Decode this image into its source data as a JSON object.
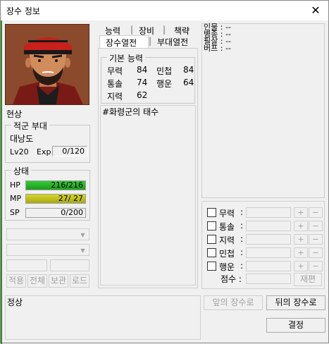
{
  "window": {
    "title": "장수 정보",
    "close_glyph": "✕"
  },
  "general": {
    "name": "현상",
    "affiliation_label": "적군 부대",
    "location": "대낭도",
    "level": "Lv20",
    "exp_label": "Exp",
    "exp_value": "0/120"
  },
  "status": {
    "label": "상태",
    "hp_label": "HP",
    "hp_value": "216/216",
    "hp_ratio": 1.0,
    "mp_label": "MP",
    "mp_value": "27/ 27",
    "mp_ratio": 1.0,
    "sp_label": "SP",
    "sp_value": "0/200",
    "sp_ratio": 0.0,
    "hp_color": "#33cc33",
    "mp_color": "#d6d626"
  },
  "tabs": {
    "top_row": [
      "능력",
      "장비",
      "책략"
    ],
    "bottom_row": [
      "장수열전",
      "부대열전"
    ],
    "active": "장수열전"
  },
  "abilities": {
    "label": "기본 능력",
    "items": [
      {
        "name": "무력",
        "value": "84"
      },
      {
        "name": "민첩",
        "value": "84"
      },
      {
        "name": "통솔",
        "value": "74"
      },
      {
        "name": "행운",
        "value": "64"
      },
      {
        "name": "지력",
        "value": "62"
      }
    ]
  },
  "biography": "#화령군의 태수",
  "info": {
    "lines": [
      {
        "key": "인물",
        "value": ": --"
      },
      {
        "key": "병종",
        "value": ": --"
      },
      {
        "key": "필살",
        "value": ": --"
      },
      {
        "key": "버프",
        "value": ": --"
      }
    ]
  },
  "left_buttons": [
    "적용",
    "전체",
    "보관",
    "로드"
  ],
  "filter": {
    "stats": [
      "무력",
      "통솔",
      "지력",
      "민첩",
      "행운"
    ],
    "colon": ":",
    "plus": "+",
    "minus": "−",
    "score_label": "점수 :",
    "reroll_label": "재편"
  },
  "footer": {
    "condition": "정상",
    "prev_label": "앞의 장수로",
    "next_label": "뒤의 장수로",
    "confirm_label": "결정"
  }
}
